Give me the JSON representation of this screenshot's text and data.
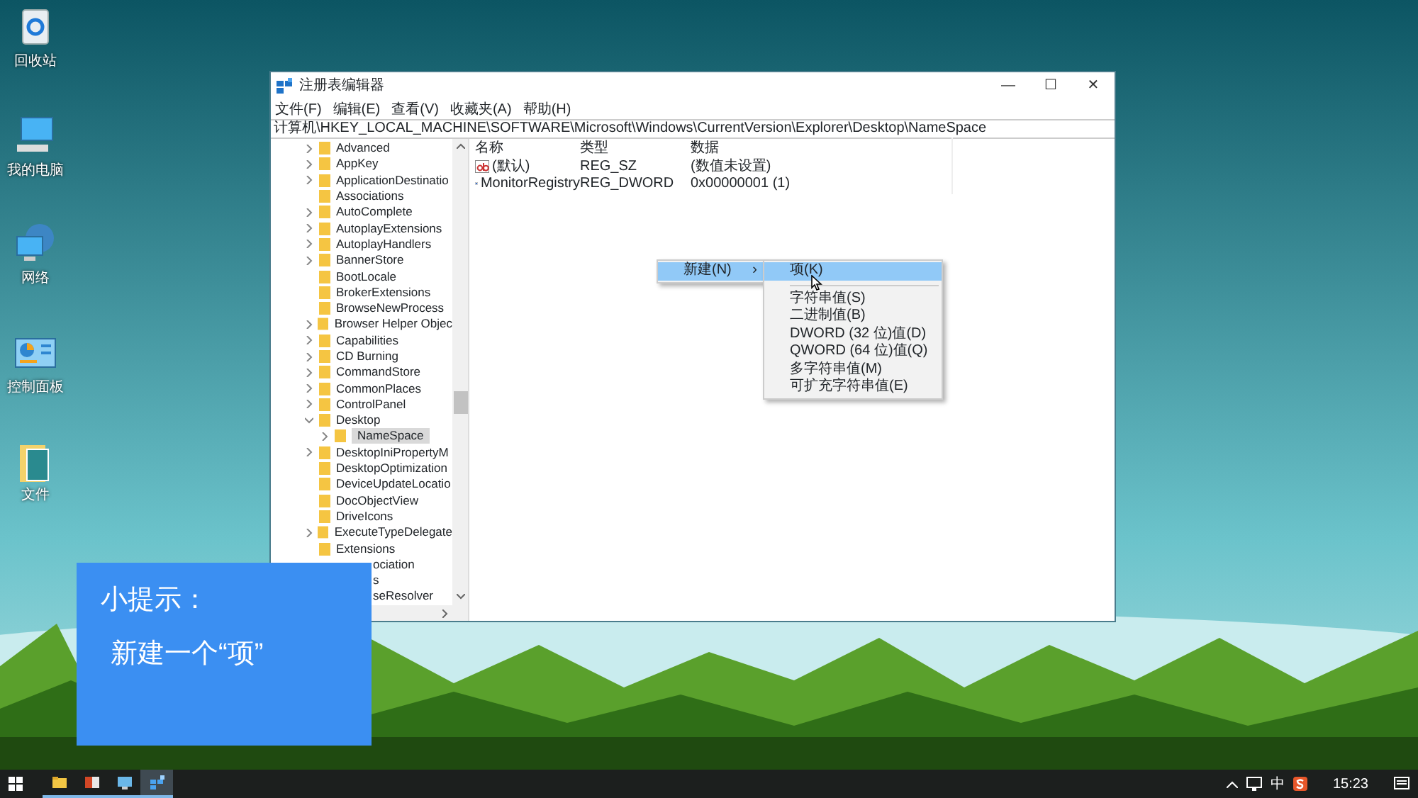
{
  "desktop_icons": [
    {
      "kind": "recycle-bin",
      "label": "回收站"
    },
    {
      "kind": "computer",
      "label": "我的电脑"
    },
    {
      "kind": "network",
      "label": "网络"
    },
    {
      "kind": "control-panel",
      "label": "控制面板"
    },
    {
      "kind": "folder",
      "label": "文件"
    }
  ],
  "window": {
    "title": "注册表编辑器",
    "controls": [
      "—",
      "☐",
      "✕"
    ],
    "menu": [
      "文件(F)",
      "编辑(E)",
      "查看(V)",
      "收藏夹(A)",
      "帮助(H)"
    ],
    "address": "计算机\\HKEY_LOCAL_MACHINE\\SOFTWARE\\Microsoft\\Windows\\CurrentVersion\\Explorer\\Desktop\\NameSpace",
    "tree": [
      {
        "label": "Advanced",
        "has_children": true,
        "expanded": false,
        "selected": false
      },
      {
        "label": "AppKey",
        "has_children": true,
        "expanded": false,
        "selected": false
      },
      {
        "label": "ApplicationDestinatio",
        "has_children": true,
        "expanded": false,
        "selected": false
      },
      {
        "label": "Associations",
        "has_children": false,
        "selected": false
      },
      {
        "label": "AutoComplete",
        "has_children": true,
        "expanded": false,
        "selected": false
      },
      {
        "label": "AutoplayExtensions",
        "has_children": true,
        "expanded": false,
        "selected": false
      },
      {
        "label": "AutoplayHandlers",
        "has_children": true,
        "expanded": false,
        "selected": false
      },
      {
        "label": "BannerStore",
        "has_children": true,
        "expanded": false,
        "selected": false
      },
      {
        "label": "BootLocale",
        "has_children": false,
        "selected": false
      },
      {
        "label": "BrokerExtensions",
        "has_children": false,
        "selected": false
      },
      {
        "label": "BrowseNewProcess",
        "has_children": false,
        "selected": false
      },
      {
        "label": "Browser Helper Objec",
        "has_children": true,
        "expanded": false,
        "selected": false
      },
      {
        "label": "Capabilities",
        "has_children": true,
        "expanded": false,
        "selected": false
      },
      {
        "label": "CD Burning",
        "has_children": true,
        "expanded": false,
        "selected": false
      },
      {
        "label": "CommandStore",
        "has_children": true,
        "expanded": false,
        "selected": false
      },
      {
        "label": "CommonPlaces",
        "has_children": true,
        "expanded": false,
        "selected": false
      },
      {
        "label": "ControlPanel",
        "has_children": true,
        "expanded": false,
        "selected": false
      },
      {
        "label": "Desktop",
        "has_children": true,
        "expanded": true,
        "selected": false,
        "children": [
          {
            "label": "NameSpace",
            "has_children": true,
            "expanded": false,
            "selected": true
          }
        ]
      },
      {
        "label": "DesktopIniPropertyM",
        "has_children": true,
        "expanded": false,
        "selected": false
      },
      {
        "label": "DesktopOptimization",
        "has_children": false,
        "selected": false
      },
      {
        "label": "DeviceUpdateLocatio",
        "has_children": false,
        "selected": false
      },
      {
        "label": "DocObjectView",
        "has_children": false,
        "selected": false
      },
      {
        "label": "DriveIcons",
        "has_children": false,
        "selected": false
      },
      {
        "label": "ExecuteTypeDelegate",
        "has_children": true,
        "expanded": false,
        "selected": false
      },
      {
        "label": "Extensions",
        "has_children": false,
        "selected": false
      },
      {
        "label": "ociation",
        "covered": true
      },
      {
        "label": "s",
        "covered": true
      },
      {
        "label": "seResolver",
        "covered": true
      }
    ],
    "columns": [
      "名称",
      "类型",
      "数据"
    ],
    "rows": [
      {
        "kind": "string",
        "name": "(默认)",
        "type": "REG_SZ",
        "data": "(数值未设置)"
      },
      {
        "kind": "dword",
        "name": "MonitorRegistry",
        "type": "REG_DWORD",
        "data": "0x00000001 (1)"
      }
    ],
    "context_menu": [
      {
        "label": "新建(N)",
        "arrow": "›",
        "selected": true
      }
    ],
    "submenu": [
      {
        "kind": "item",
        "label": "项(K)",
        "selected": true
      },
      {
        "kind": "separator"
      },
      {
        "kind": "item",
        "label": "字符串值(S)",
        "selected": false
      },
      {
        "kind": "item",
        "label": "二进制值(B)",
        "selected": false
      },
      {
        "kind": "item",
        "label": "DWORD (32 位)值(D)",
        "selected": false
      },
      {
        "kind": "item",
        "label": "QWORD (64 位)值(Q)",
        "selected": false
      },
      {
        "kind": "item",
        "label": "多字符串值(M)",
        "selected": false
      },
      {
        "kind": "item",
        "label": "可扩充字符串值(E)",
        "selected": false
      }
    ]
  },
  "tip": {
    "title": "小提示：",
    "text": "新建一个“项”"
  },
  "taskbar": {
    "apps": [
      {
        "kind": "explorer",
        "selected": false
      },
      {
        "kind": "office",
        "selected": false
      },
      {
        "kind": "app",
        "selected": false
      },
      {
        "kind": "regedit",
        "selected": true
      }
    ],
    "ime": "中",
    "time": "15:23"
  }
}
